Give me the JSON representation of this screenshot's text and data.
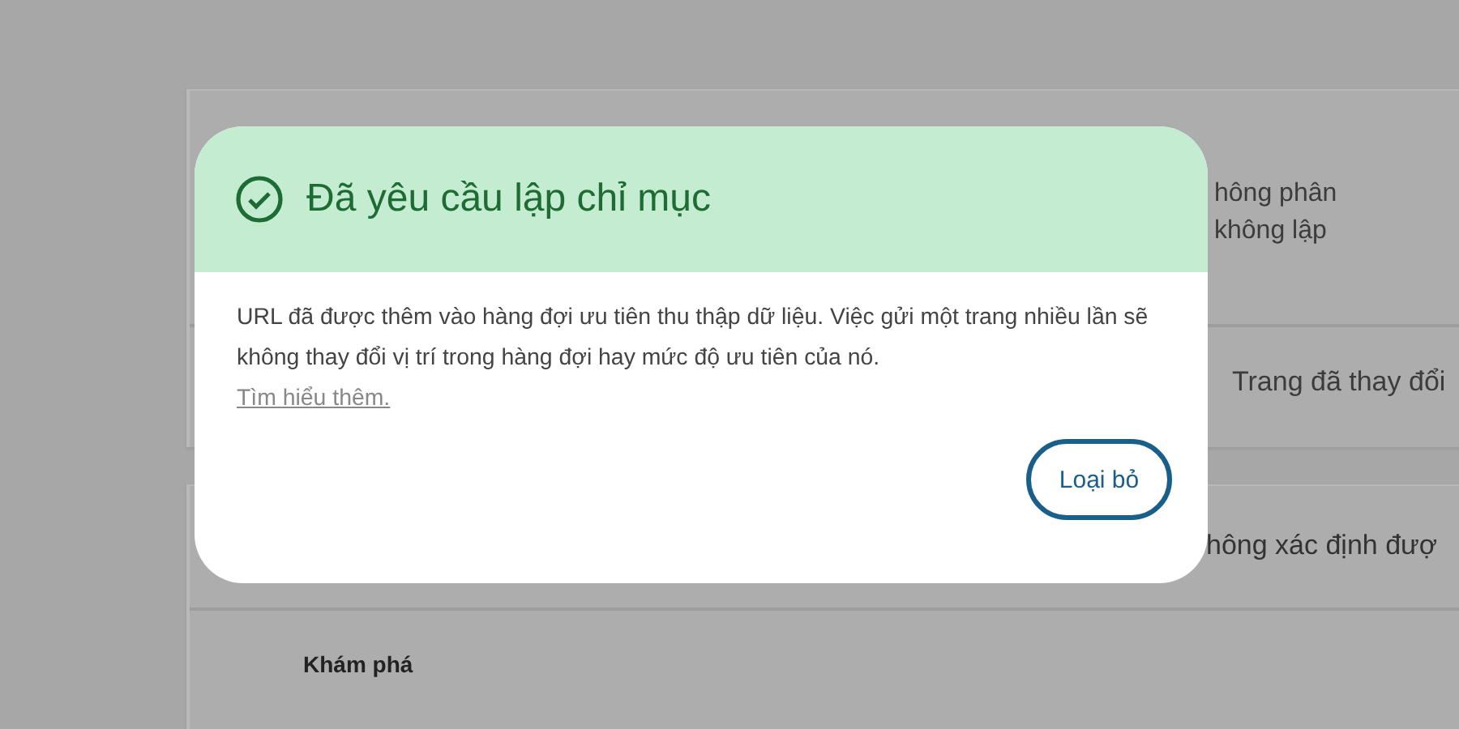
{
  "background": {
    "card_1": {
      "lines": [
        "hông phân",
        "không lập"
      ],
      "footer": "Trang đã thay đổi"
    },
    "card_2": {
      "line": "hông xác định đượ",
      "section": "Khám phá"
    }
  },
  "dialog": {
    "title": "Đã yêu cầu lập chỉ mục",
    "message": "URL đã được thêm vào hàng đợi ưu tiên thu thập dữ liệu. Việc gửi một trang nhiều lần sẽ không thay đổi vị trí trong hàng đợi hay mức độ ưu tiên của nó.",
    "link": "Tìm hiểu thêm.",
    "button": "Loại bỏ"
  }
}
